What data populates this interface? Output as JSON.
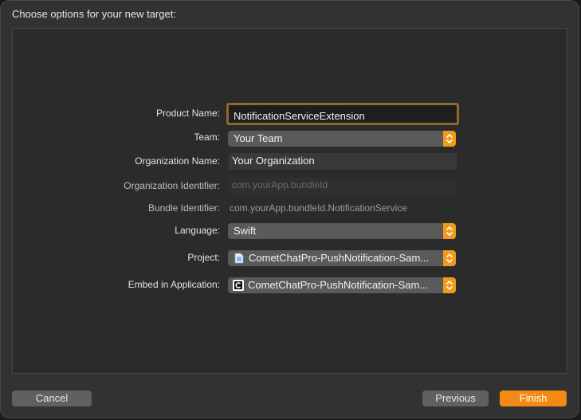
{
  "dialog": {
    "title": "Choose options for your new target:"
  },
  "form": {
    "product_name": {
      "label": "Product Name:",
      "value": "NotificationServiceExtension"
    },
    "team": {
      "label": "Team:",
      "value": "Your Team",
      "icon": "chevron-updown-icon"
    },
    "organization_name": {
      "label": "Organization Name:",
      "value": "Your Organization"
    },
    "organization_identifier": {
      "label": "Organization Identifier:",
      "placeholder": "com.yourApp.bundleId"
    },
    "bundle_identifier": {
      "label": "Bundle Identifier:",
      "value": "com.yourApp.bundleId.NotificationService"
    },
    "language": {
      "label": "Language:",
      "value": "Swift"
    },
    "project": {
      "label": "Project:",
      "value": "CometChatPro-PushNotification-Sam...",
      "icon": "project-file-icon"
    },
    "embed": {
      "label": "Embed in Application:",
      "value": "CometChatPro-PushNotification-Sam...",
      "icon": "app-icon"
    }
  },
  "buttons": {
    "cancel": "Cancel",
    "previous": "Previous",
    "finish": "Finish"
  },
  "colors": {
    "accent": "#f28a14",
    "focus_ring": "#8c6a2e",
    "window_bg": "#323232"
  }
}
